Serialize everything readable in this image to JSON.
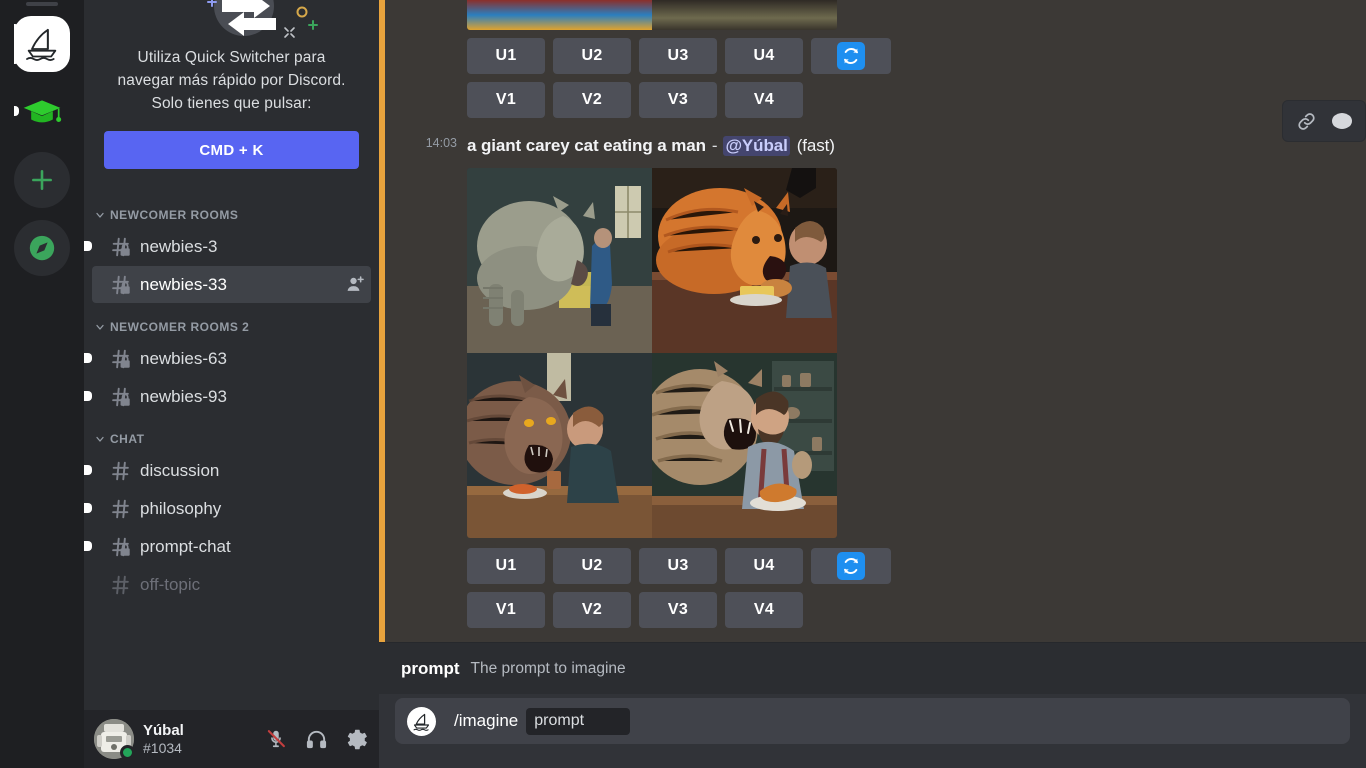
{
  "server_rail": {
    "servers": [
      {
        "name": "Midjourney",
        "icon": "sailboat-icon",
        "active": true,
        "unread": false
      },
      {
        "name": "Education Server",
        "icon": "graduation-cap-icon",
        "active": false,
        "unread": true
      },
      {
        "name": "Add a Server",
        "icon": "plus-icon",
        "active": false,
        "unread": false
      },
      {
        "name": "Explore Discoverable Servers",
        "icon": "compass-icon",
        "active": false,
        "unread": false
      }
    ]
  },
  "sidebar": {
    "quick_switcher": {
      "line1": "Utiliza Quick Switcher para",
      "line2": "navegar más rápido por Discord.",
      "line3": "Solo tienes que pulsar:",
      "button_label": "CMD + K",
      "icon": "switch-arrows-icon"
    },
    "categories": [
      {
        "label": "NEWCOMER ROOMS",
        "channels": [
          {
            "name": "newbies-3",
            "icon": "hash-lock-icon",
            "unread": true,
            "active": false,
            "muted": false,
            "action": null
          },
          {
            "name": "newbies-33",
            "icon": "hash-lock-icon",
            "unread": false,
            "active": true,
            "muted": false,
            "action": "add-member-icon"
          }
        ]
      },
      {
        "label": "NEWCOMER ROOMS 2",
        "channels": [
          {
            "name": "newbies-63",
            "icon": "hash-lock-icon",
            "unread": true,
            "active": false,
            "muted": false,
            "action": null
          },
          {
            "name": "newbies-93",
            "icon": "hash-lock-icon",
            "unread": true,
            "active": false,
            "muted": false,
            "action": null
          }
        ]
      },
      {
        "label": "CHAT",
        "channels": [
          {
            "name": "discussion",
            "icon": "hash-icon",
            "unread": true,
            "active": false,
            "muted": false,
            "action": null
          },
          {
            "name": "philosophy",
            "icon": "hash-icon",
            "unread": true,
            "active": false,
            "muted": false,
            "action": null
          },
          {
            "name": "prompt-chat",
            "icon": "hash-lock-icon",
            "unread": true,
            "active": false,
            "muted": false,
            "action": null
          },
          {
            "name": "off-topic",
            "icon": "hash-icon",
            "unread": false,
            "active": false,
            "muted": true,
            "action": null
          }
        ]
      }
    ],
    "user_panel": {
      "username": "Yúbal",
      "discriminator": "#1034",
      "status": "online",
      "avatar": "robot-avatar",
      "controls": [
        {
          "name": "microphone-muted-icon",
          "label": "Mute"
        },
        {
          "name": "headphones-icon",
          "label": "Deafen"
        },
        {
          "name": "gear-icon",
          "label": "User Settings"
        }
      ]
    }
  },
  "main": {
    "top_message": {
      "buttons_row1": [
        "U1",
        "U2",
        "U3",
        "U4"
      ],
      "buttons_row2": [
        "V1",
        "V2",
        "V3",
        "V4"
      ],
      "refresh_icon": "refresh-icon"
    },
    "message": {
      "timestamp": "14:03",
      "prompt_text": "a giant carey cat eating a man",
      "separator": "-",
      "mention": "@Yúbal",
      "mode": "(fast)",
      "buttons_row1": [
        "U1",
        "U2",
        "U3",
        "U4"
      ],
      "buttons_row2": [
        "V1",
        "V2",
        "V3",
        "V4"
      ],
      "refresh_icon": "refresh-icon",
      "image_grid": {
        "cells": [
          {
            "position": "top-left",
            "alt": "Giant grey cat facing a person in a dim room"
          },
          {
            "position": "top-right",
            "alt": "Giant orange cat facing a man at a table"
          },
          {
            "position": "bottom-left",
            "alt": "Giant cat roaring at a bearded man across a table"
          },
          {
            "position": "bottom-right",
            "alt": "Giant striped cat biting a bearded man holding a plate"
          }
        ]
      }
    },
    "hover_toolbar": [
      {
        "name": "link-icon",
        "label": "Copy Link"
      },
      {
        "name": "more-icon",
        "label": "More"
      }
    ],
    "composer": {
      "option_name": "prompt",
      "option_description": "The prompt to imagine",
      "command_name": "/imagine",
      "command_chip": "prompt",
      "bot_avatar": "sailboat-icon"
    }
  },
  "colors": {
    "brand": "#5865f2",
    "accent_divider": "#e8a33d",
    "refresh_blue": "#1e8ff0",
    "online_green": "#23a55a",
    "button_gray": "#4e5058",
    "mention": "#c9cdfb"
  }
}
